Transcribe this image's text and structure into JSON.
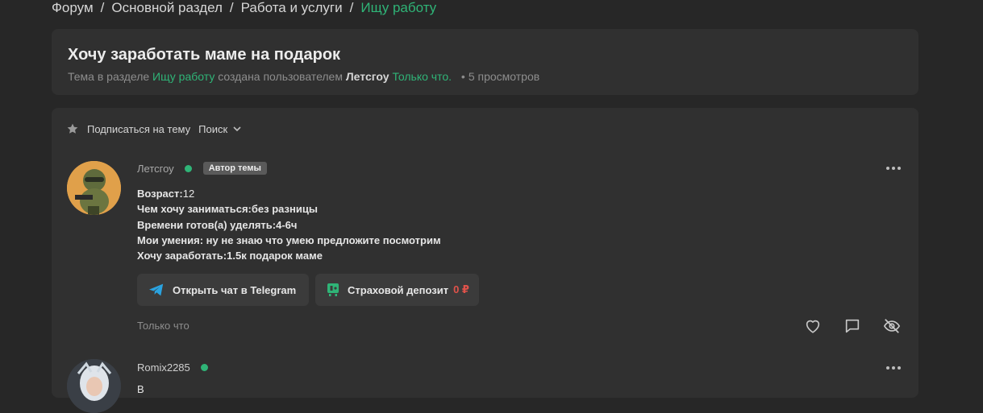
{
  "breadcrumb": {
    "items": [
      "Форум",
      "Основной раздел",
      "Работа и услуги"
    ],
    "current": "Ищу работу",
    "separator": "/"
  },
  "thread": {
    "title": "Хочу заработать маме на подарок",
    "meta_prefix": "Тема в разделе",
    "meta_section": "Ищу работу",
    "meta_created_by": "создана пользователем",
    "meta_author": "Летсгоу",
    "meta_time": "Только что.",
    "meta_dot": "•",
    "meta_views": "5 просмотров"
  },
  "toolbar": {
    "subscribe_label": "Подписаться на тему",
    "search_label": "Поиск"
  },
  "posts": [
    {
      "author": "Летсгоу",
      "badge": "Автор темы",
      "lines": [
        {
          "label": "Возраст:",
          "value": "12"
        },
        {
          "label": "Чем хочу заниматься:без разницы",
          "value": ""
        },
        {
          "label": "Времени готов(а) уделять:4-6ч",
          "value": ""
        },
        {
          "label": "Мои умения: ну не знаю что умею предложите посмотрим",
          "value": ""
        },
        {
          "label": "Хочу заработать:1.5к подарок маме",
          "value": ""
        }
      ],
      "telegram_button": "Открыть чат в Telegram",
      "deposit_button": "Страховой депозит",
      "deposit_value": "0 ₽",
      "time": "Только что"
    },
    {
      "author": "Romix2285",
      "partial_line": "В"
    }
  ],
  "icons": {
    "subscribe": "star-icon",
    "search_dropdown": "chevron-down-icon",
    "more": "more-dots-icon",
    "telegram": "telegram-icon",
    "deposit": "deposit-icon",
    "like": "heart-icon",
    "reply": "comment-icon",
    "hide": "eye-off-icon"
  },
  "colors": {
    "background": "#272727",
    "panel": "#303030",
    "accent_green": "#2fb477",
    "telegram_blue": "#2aa3e0",
    "deposit_red": "#e0524a"
  }
}
